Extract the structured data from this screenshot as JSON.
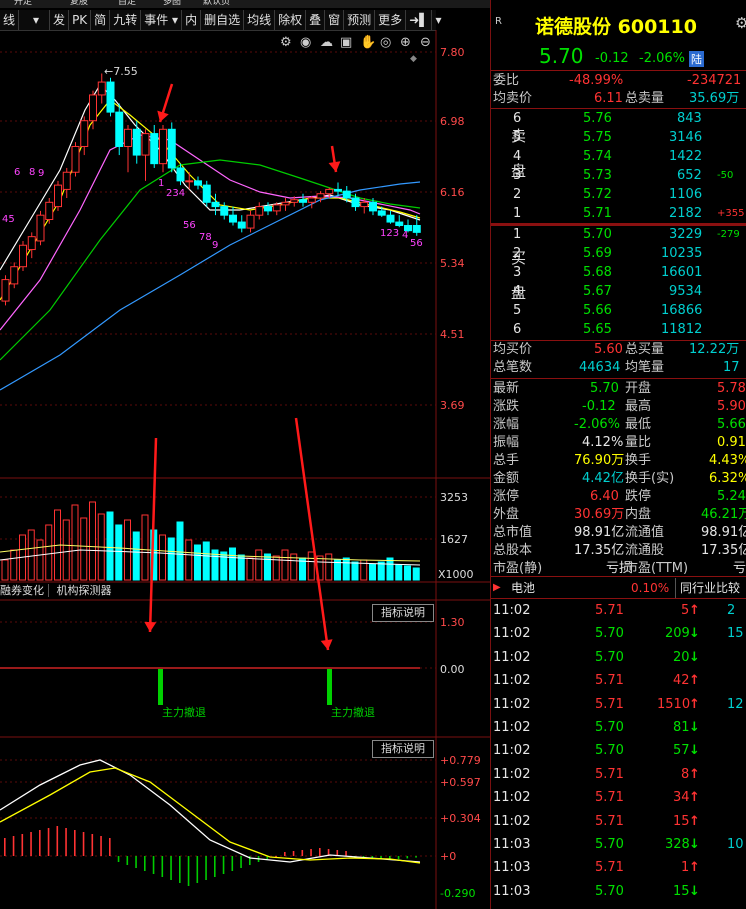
{
  "top_tabs": [
    "开走",
    "复股",
    "自走",
    "多图",
    "默认页"
  ],
  "toolbar": [
    "线",
    "发",
    "PK",
    "简",
    "九转",
    "事件",
    "内",
    "删自选",
    "均线",
    "除权",
    "叠",
    "窗",
    "预测",
    "更多"
  ],
  "chart_icons": [
    "gear-icon",
    "eye-icon",
    "cloud-icon",
    "box-icon",
    "hand-icon",
    "target-icon",
    "zoom-in-icon",
    "zoom-out-icon"
  ],
  "price_axis": [
    "7.80",
    "6.98",
    "6.16",
    "5.34",
    "4.51",
    "3.69"
  ],
  "high_marker": "7.55",
  "seq_labels": {
    "up_left": [
      "45",
      "6",
      "8",
      "9"
    ],
    "down_a": [
      "1",
      "234",
      "56",
      "78",
      "9"
    ],
    "down_b": [
      "123",
      "4",
      "56"
    ]
  },
  "volume_axis": [
    "3253",
    "1627",
    "X1000"
  ],
  "panel_tabs": [
    "融券变化",
    "机构探测器"
  ],
  "indicator_btn": "指标说明",
  "flow_axis": [
    "1.30",
    "0.00"
  ],
  "flow_labels": [
    "主力撤退",
    "主力撤退"
  ],
  "macd_axis": [
    "+0.779",
    "+0.597",
    "+0.304",
    "+0",
    "-0.290"
  ],
  "quote": {
    "tag": "R",
    "name": "诺德股份",
    "code": "600110",
    "price": "5.70",
    "change": "-0.12",
    "pct": "-2.06%",
    "exchange": "陆",
    "weibi_label": "委比",
    "weibi": "-48.99%",
    "weicha": "-234721",
    "avg_sell_label": "均卖价",
    "avg_sell": "6.11",
    "total_sell_label": "总卖量",
    "total_sell": "35.69万",
    "sell_side": "卖盘",
    "buy_side": "买盘",
    "sells": [
      {
        "lvl": "6",
        "price": "5.76",
        "vol": "843",
        "chg": ""
      },
      {
        "lvl": "5",
        "price": "5.75",
        "vol": "3146",
        "chg": ""
      },
      {
        "lvl": "4",
        "price": "5.74",
        "vol": "1422",
        "chg": ""
      },
      {
        "lvl": "3",
        "price": "5.73",
        "vol": "652",
        "chg": "-50"
      },
      {
        "lvl": "2",
        "price": "5.72",
        "vol": "1106",
        "chg": ""
      },
      {
        "lvl": "1",
        "price": "5.71",
        "vol": "2182",
        "chg": "+355"
      }
    ],
    "buys": [
      {
        "lvl": "1",
        "price": "5.70",
        "vol": "3229",
        "chg": "-279"
      },
      {
        "lvl": "2",
        "price": "5.69",
        "vol": "10235",
        "chg": ""
      },
      {
        "lvl": "3",
        "price": "5.68",
        "vol": "16601",
        "chg": ""
      },
      {
        "lvl": "4",
        "price": "5.67",
        "vol": "9534",
        "chg": ""
      },
      {
        "lvl": "5",
        "price": "5.66",
        "vol": "16866",
        "chg": ""
      },
      {
        "lvl": "6",
        "price": "5.65",
        "vol": "11812",
        "chg": ""
      }
    ],
    "avg_buy_label": "均买价",
    "avg_buy": "5.60",
    "total_buy_label": "总买量",
    "total_buy": "12.22万",
    "total_count_label": "总笔数",
    "total_count": "44634",
    "avg_count_label": "均笔量",
    "avg_count": "17",
    "stats": [
      {
        "l1": "最新",
        "v1": "5.70",
        "c1": "green",
        "l2": "开盘",
        "v2": "5.78",
        "c2": "red"
      },
      {
        "l1": "涨跌",
        "v1": "-0.12",
        "c1": "green",
        "l2": "最高",
        "v2": "5.90",
        "c2": "red"
      },
      {
        "l1": "涨幅",
        "v1": "-2.06%",
        "c1": "green",
        "l2": "最低",
        "v2": "5.66",
        "c2": "green"
      },
      {
        "l1": "振幅",
        "v1": "4.12%",
        "c1": "white",
        "l2": "量比",
        "v2": "0.91",
        "c2": "yellow"
      },
      {
        "l1": "总手",
        "v1": "76.90万",
        "c1": "yellow",
        "l2": "换手",
        "v2": "4.43%",
        "c2": "yellow"
      },
      {
        "l1": "金额",
        "v1": "4.42亿",
        "c1": "cyan",
        "l2": "换手(实)",
        "v2": "6.32%",
        "c2": "yellow"
      },
      {
        "l1": "涨停",
        "v1": "6.40",
        "c1": "red",
        "l2": "跌停",
        "v2": "5.24",
        "c2": "green"
      },
      {
        "l1": "外盘",
        "v1": "30.69万",
        "c1": "red",
        "l2": "内盘",
        "v2": "46.21万",
        "c2": "green"
      },
      {
        "l1": "总市值",
        "v1": "98.91亿",
        "c1": "white",
        "l2": "流通值",
        "v2": "98.91亿",
        "c2": "white"
      },
      {
        "l1": "总股本",
        "v1": "17.35亿",
        "c1": "white",
        "l2": "流通股",
        "v2": "17.35亿",
        "c2": "white"
      },
      {
        "l1": "市盈(静)",
        "v1": "亏损",
        "c1": "white",
        "l2": "市盈(TTM)",
        "v2": "亏损",
        "c2": "white"
      }
    ],
    "sector_name": "电池",
    "sector_pct": "0.10%",
    "peer_btn": "同行业比较",
    "ticks": [
      {
        "t": "11:02",
        "p": "5.71",
        "pc": "red",
        "v": "5",
        "dir": "up",
        "x": "2"
      },
      {
        "t": "11:02",
        "p": "5.70",
        "pc": "green",
        "v": "209",
        "dir": "down",
        "x": "15"
      },
      {
        "t": "11:02",
        "p": "5.70",
        "pc": "green",
        "v": "20",
        "dir": "down",
        "x": ""
      },
      {
        "t": "11:02",
        "p": "5.71",
        "pc": "red",
        "v": "42",
        "dir": "up",
        "x": ""
      },
      {
        "t": "11:02",
        "p": "5.71",
        "pc": "red",
        "v": "1510",
        "dir": "up",
        "x": "12"
      },
      {
        "t": "11:02",
        "p": "5.70",
        "pc": "green",
        "v": "81",
        "dir": "down",
        "x": ""
      },
      {
        "t": "11:02",
        "p": "5.70",
        "pc": "green",
        "v": "57",
        "dir": "down",
        "x": ""
      },
      {
        "t": "11:02",
        "p": "5.71",
        "pc": "red",
        "v": "8",
        "dir": "up",
        "x": ""
      },
      {
        "t": "11:02",
        "p": "5.71",
        "pc": "red",
        "v": "34",
        "dir": "up",
        "x": ""
      },
      {
        "t": "11:02",
        "p": "5.71",
        "pc": "red",
        "v": "15",
        "dir": "up",
        "x": ""
      },
      {
        "t": "11:03",
        "p": "5.70",
        "pc": "green",
        "v": "328",
        "dir": "down",
        "x": "10"
      },
      {
        "t": "11:03",
        "p": "5.71",
        "pc": "red",
        "v": "1",
        "dir": "up",
        "x": ""
      },
      {
        "t": "11:03",
        "p": "5.70",
        "pc": "green",
        "v": "15",
        "dir": "down",
        "x": ""
      }
    ]
  },
  "colors": {
    "up": "#ff3333",
    "down": "#00ffff",
    "flow_bar": "#00d000",
    "arrow": "#ff1a1a",
    "ma5": "#ffffff",
    "ma10": "#ffff00",
    "ma20": "#ff66ff",
    "ma30": "#00cc00",
    "ma60": "#3399ff"
  }
}
